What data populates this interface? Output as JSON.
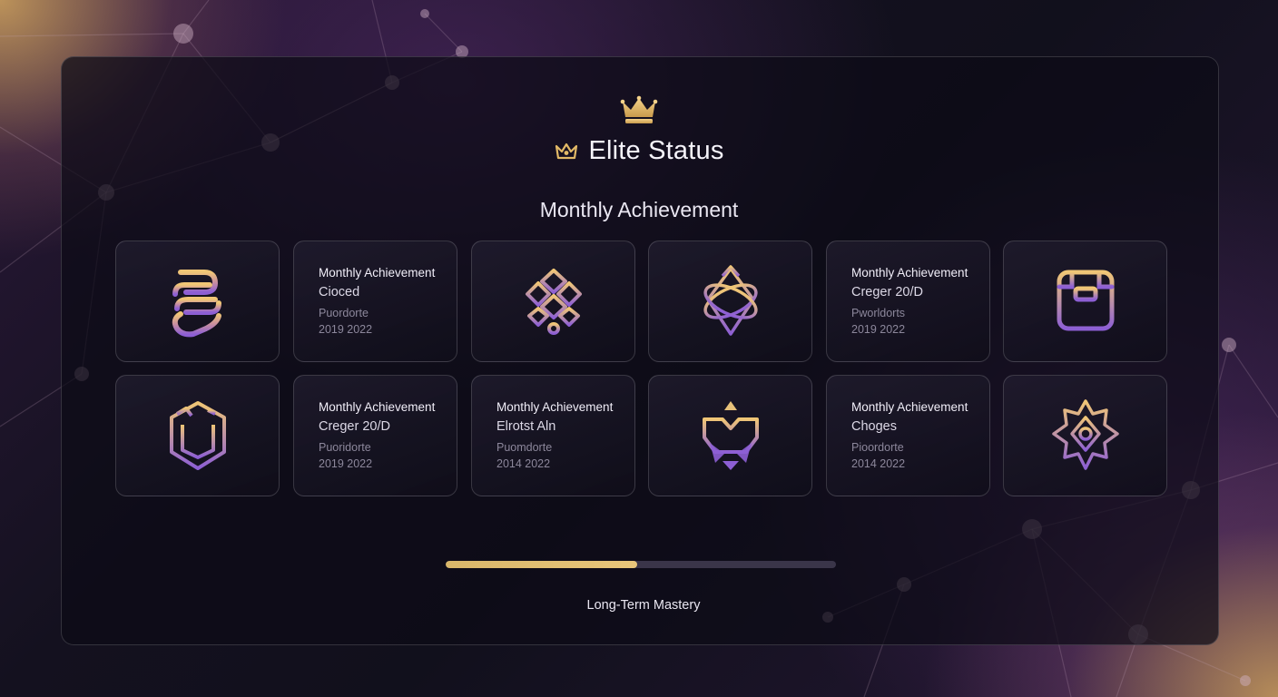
{
  "header": {
    "title": "Elite Status",
    "subtitle": "Monthly Achievement"
  },
  "colors": {
    "gold": "#e2b967",
    "purple": "#8b5fd0",
    "panel_border": "#3b3848",
    "progress_track": "#3a3549",
    "progress_fill": "#e2c17a"
  },
  "cards": [
    {
      "type": "icon",
      "icon": "chain-link-badge-icon"
    },
    {
      "type": "text",
      "title": "Monthly Achievement",
      "name": "Cioced",
      "label": "Puordorte",
      "date": "2019 2022"
    },
    {
      "type": "icon",
      "icon": "knot-badge-icon"
    },
    {
      "type": "icon",
      "icon": "orbit-diamond-badge-icon"
    },
    {
      "type": "text",
      "title": "Monthly Achievement",
      "name": "Creger 20/D",
      "label": "Pworldorts",
      "date": "2019 2022"
    },
    {
      "type": "icon",
      "icon": "square-frame-badge-icon"
    },
    {
      "type": "icon",
      "icon": "hexagon-shield-badge-icon"
    },
    {
      "type": "text",
      "title": "Monthly Achievement",
      "name": "Creger 20/D",
      "label": "Puoridorte",
      "date": "2019 2022"
    },
    {
      "type": "text",
      "title": "Monthly Achievement",
      "name": "Elrotst Aln",
      "label": "Puomdorte",
      "date": "2014 2022"
    },
    {
      "type": "icon",
      "icon": "crown-star-badge-icon"
    },
    {
      "type": "text",
      "title": "Monthly Achievement",
      "name": "Choges",
      "label": "Pioordorte",
      "date": "2014 2022"
    },
    {
      "type": "icon",
      "icon": "star-burst-badge-icon"
    }
  ],
  "progress": {
    "value": 0.49,
    "label": "Long-Term Mastery"
  }
}
